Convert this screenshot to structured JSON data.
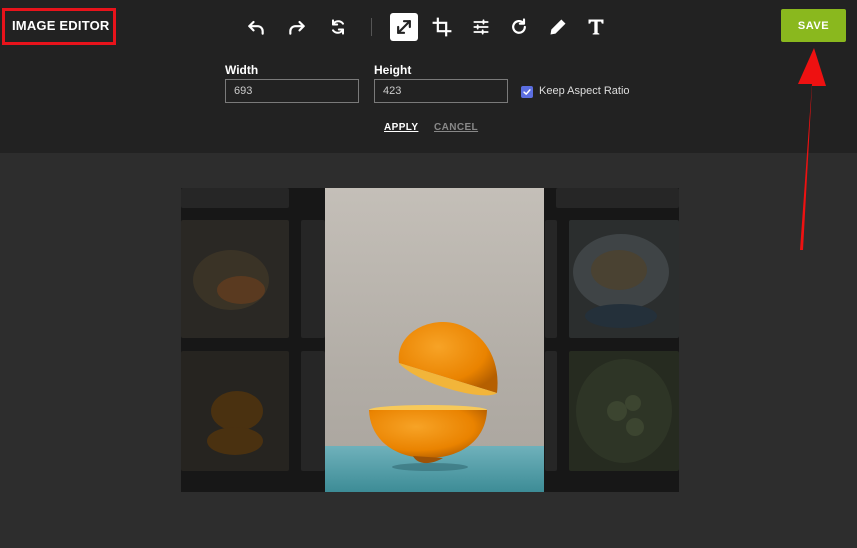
{
  "header": {
    "title": "IMAGE EDITOR",
    "save_label": "SAVE"
  },
  "toolbar": {
    "tools": [
      {
        "icon": "undo-icon"
      },
      {
        "icon": "redo-icon"
      },
      {
        "icon": "reset-icon"
      },
      {
        "icon": "resize-icon",
        "active": true
      },
      {
        "icon": "crop-icon"
      },
      {
        "icon": "adjust-icon"
      },
      {
        "icon": "rotate-icon"
      },
      {
        "icon": "draw-icon"
      },
      {
        "icon": "text-icon"
      }
    ]
  },
  "resize": {
    "width_label": "Width",
    "width_value": "693",
    "height_label": "Height",
    "height_value": "423",
    "keep_aspect_label": "Keep Aspect Ratio",
    "keep_aspect_checked": true,
    "apply_label": "APPLY",
    "cancel_label": "CANCEL"
  },
  "colors": {
    "accent": "#8ab81e",
    "highlight": "#e8131b",
    "checkbox": "#5b6ee1"
  }
}
